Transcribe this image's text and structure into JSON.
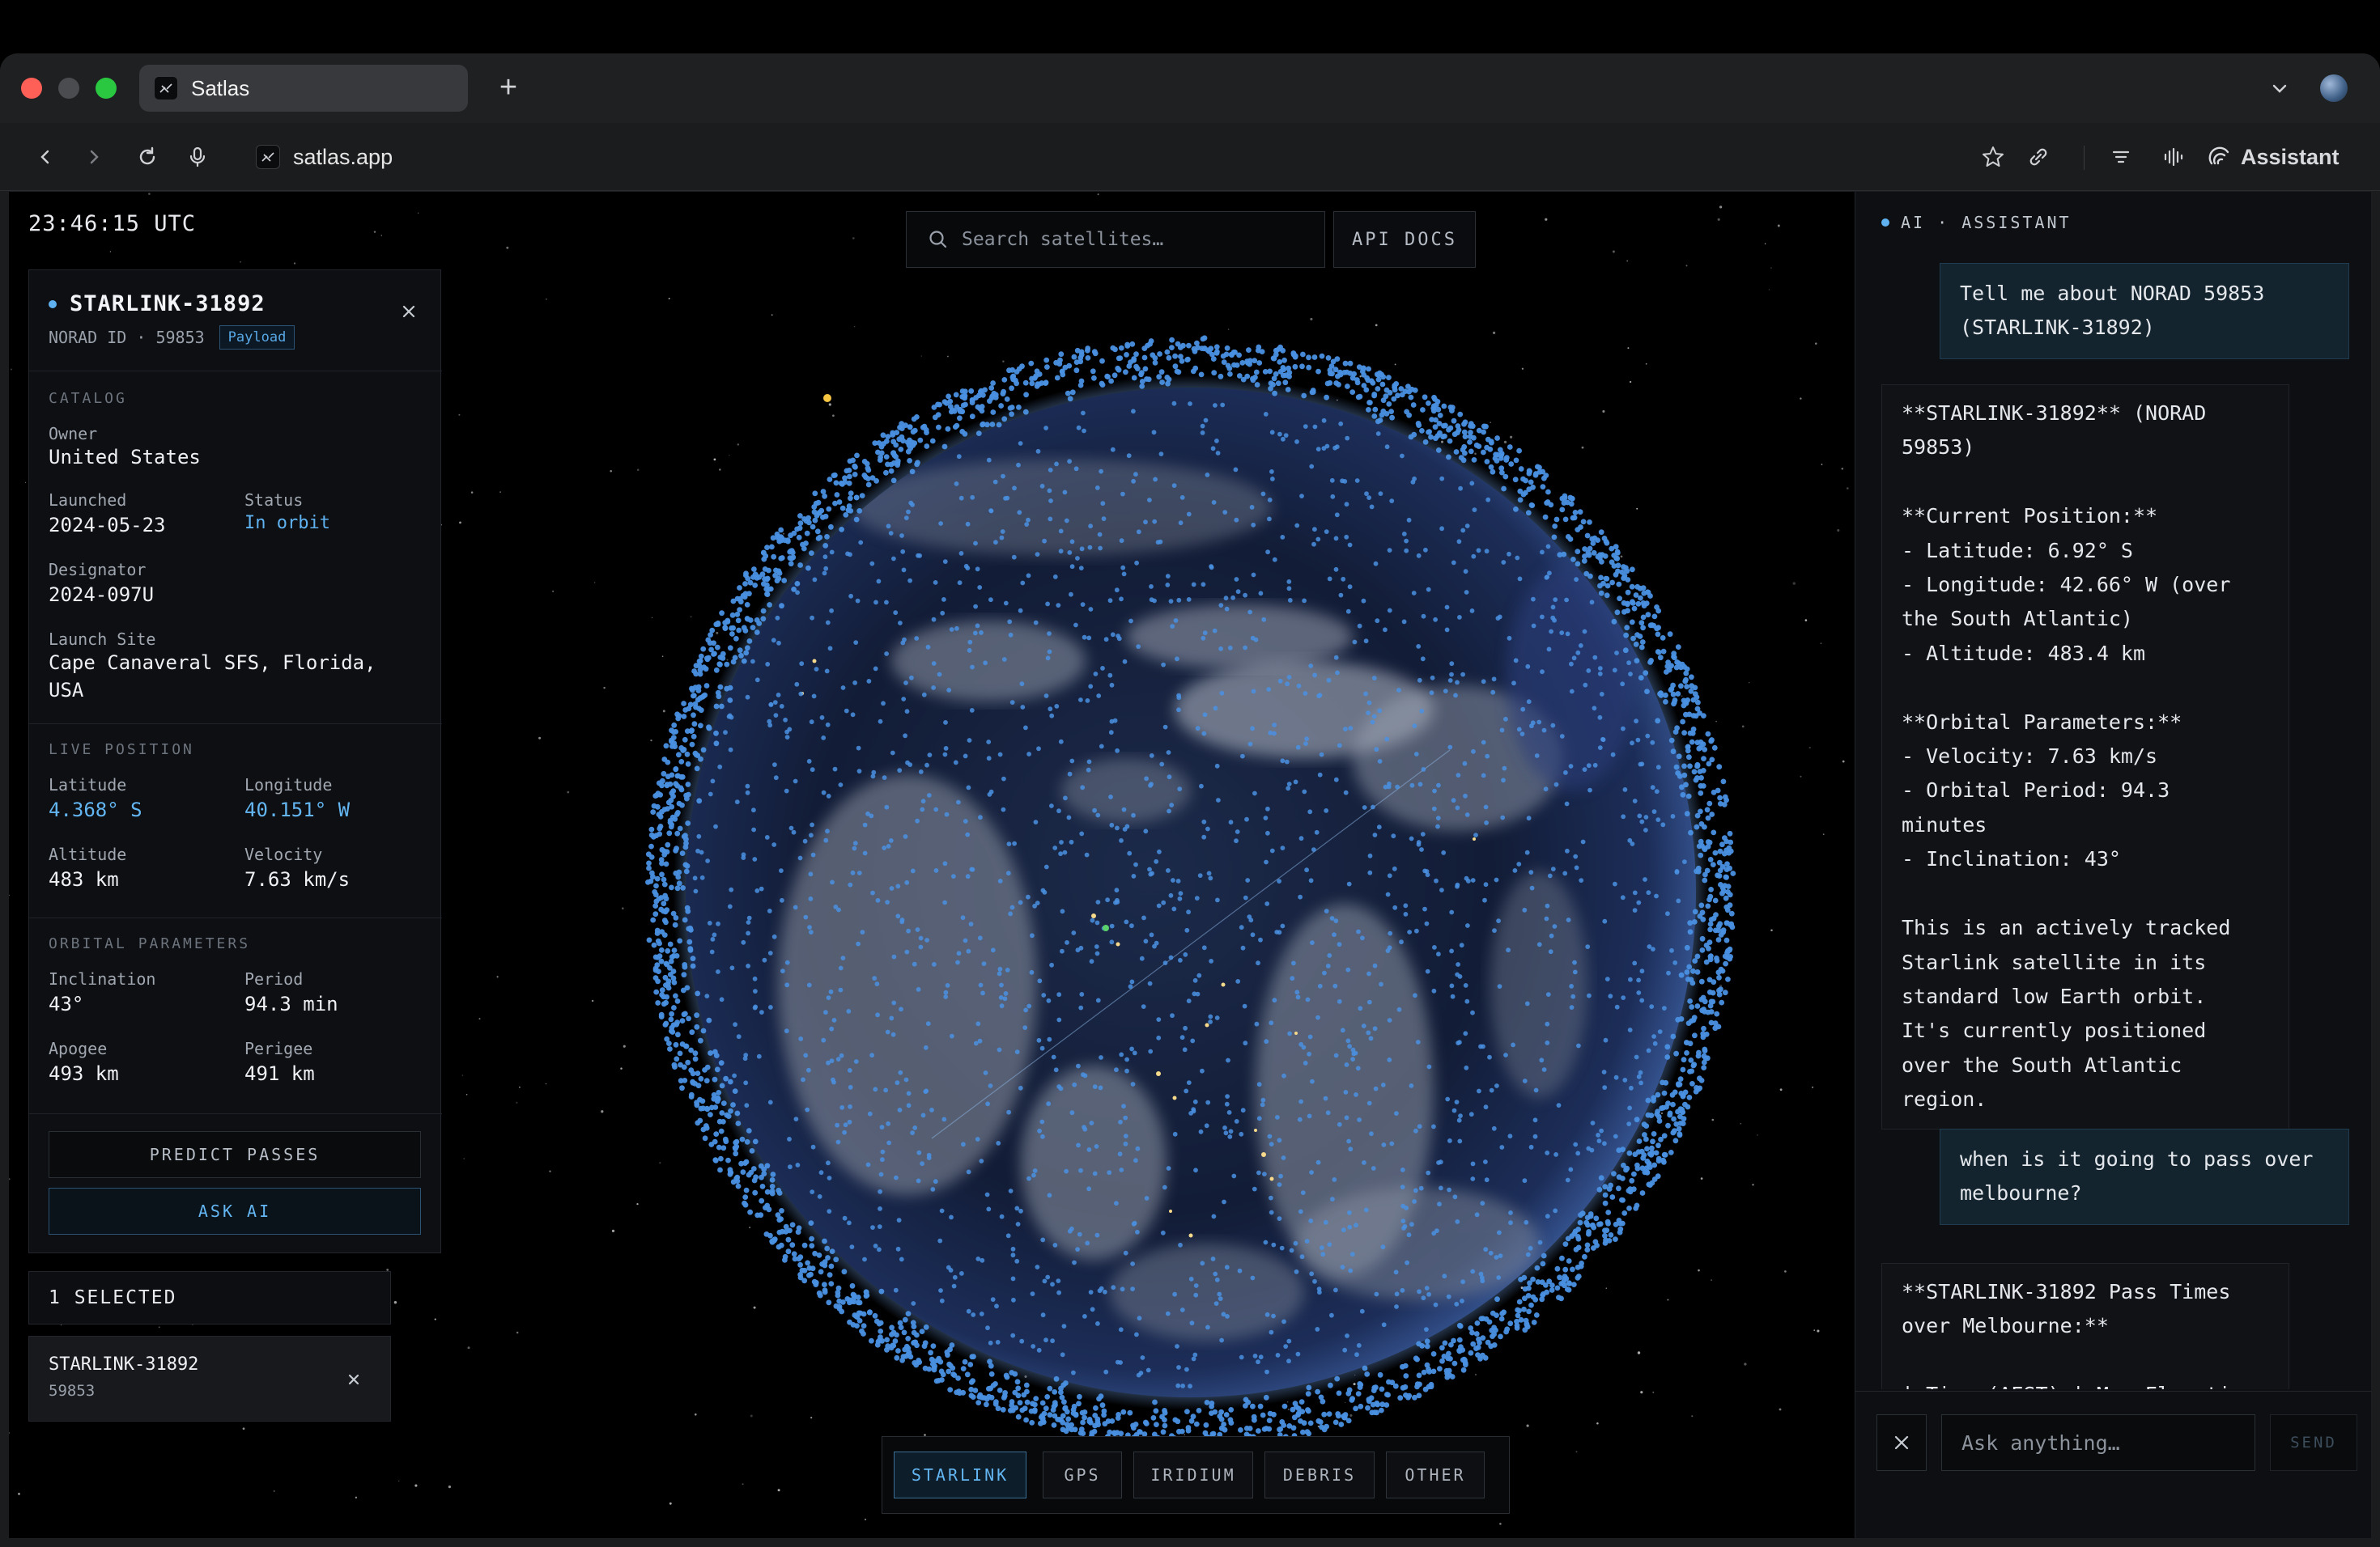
{
  "browser": {
    "tab_title": "Satlas",
    "url": "satlas.app",
    "assistant_label": "Assistant"
  },
  "app": {
    "utc_clock": "23:46:15 UTC",
    "search": {
      "placeholder": "Search satellites…"
    },
    "api_docs_label": "API DOCS",
    "categories": [
      "STARLINK",
      "GPS",
      "IRIDIUM",
      "DEBRIS",
      "OTHER"
    ],
    "active_category": "STARLINK"
  },
  "detail": {
    "name": "STARLINK-31892",
    "norad_line": "NORAD ID · 59853",
    "type_badge": "Payload",
    "catalog": {
      "heading": "CATALOG",
      "owner_label": "Owner",
      "owner": "United States",
      "launched_label": "Launched",
      "launched": "2024-05-23",
      "status_label": "Status",
      "status": "In orbit",
      "designator_label": "Designator",
      "designator": "2024-097U",
      "launch_site_label": "Launch Site",
      "launch_site": "Cape Canaveral SFS, Florida, USA"
    },
    "live": {
      "heading": "LIVE POSITION",
      "lat_label": "Latitude",
      "lat": "4.368° S",
      "lon_label": "Longitude",
      "lon": "40.151° W",
      "alt_label": "Altitude",
      "alt": "483 km",
      "vel_label": "Velocity",
      "vel": "7.63 km/s"
    },
    "orbital": {
      "heading": "ORBITAL PARAMETERS",
      "incl_label": "Inclination",
      "incl": "43°",
      "period_label": "Period",
      "period": "94.3 min",
      "apogee_label": "Apogee",
      "apogee": "493 km",
      "perigee_label": "Perigee",
      "perigee": "491 km"
    },
    "predict_label": "PREDICT PASSES",
    "ask_label": "ASK AI"
  },
  "selected": {
    "header": "1 SELECTED",
    "items": [
      {
        "name": "STARLINK-31892",
        "id": "59853"
      }
    ]
  },
  "assistant": {
    "heading": "AI · ASSISTANT",
    "messages": [
      {
        "role": "user",
        "text": "Tell me about NORAD 59853\n(STARLINK-31892)"
      },
      {
        "role": "bot",
        "text": "**STARLINK-31892** (NORAD\n59853)\n\n**Current Position:**\n- Latitude: 6.92° S\n- Longitude: 42.66° W (over\nthe South Atlantic)\n- Altitude: 483.4 km\n\n**Orbital Parameters:**\n- Velocity: 7.63 km/s\n- Orbital Period: 94.3\nminutes\n- Inclination: 43°\n\nThis is an actively tracked\nStarlink satellite in its\nstandard low Earth orbit.\nIt's currently positioned\nover the South Atlantic\nregion."
      },
      {
        "role": "user",
        "text": "when is it going to pass over\nmelbourne?"
      },
      {
        "role": "bot",
        "text": "**STARLINK-31892 Pass Times\nover Melbourne:**\n\n| Time (AEST) | Max Elevation\n| Direction |"
      }
    ],
    "input_placeholder": "Ask anything…",
    "send_label": "SEND"
  },
  "colors": {
    "accent": "#5fb2ef",
    "satellite_dot": "#4a90e2",
    "background": "#000000"
  }
}
